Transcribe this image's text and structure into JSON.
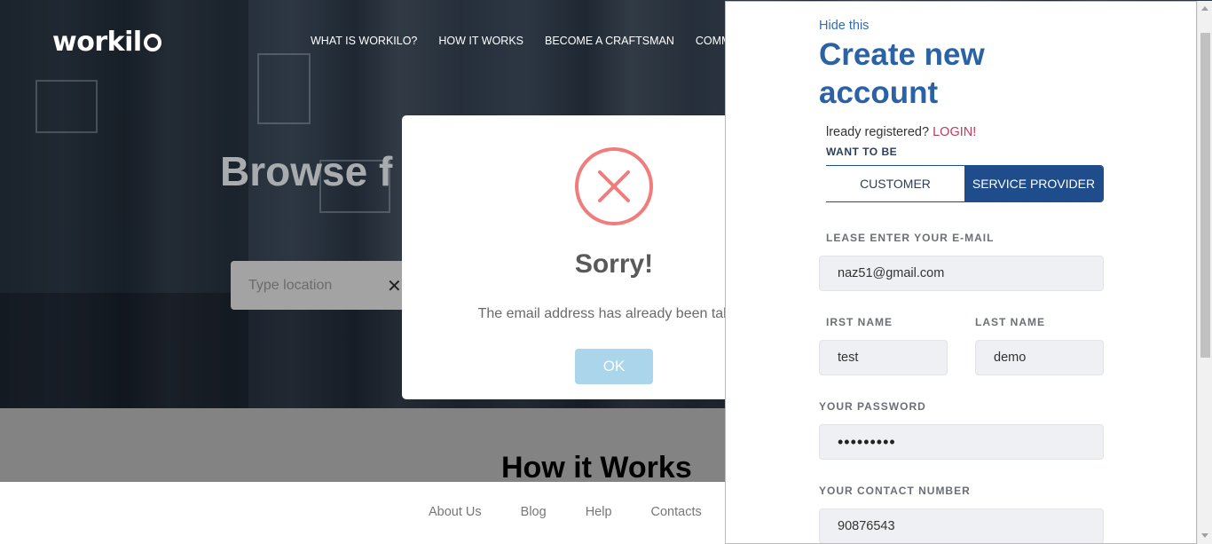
{
  "site": {
    "logo": "workil",
    "nav": [
      "WHAT IS WORKILO?",
      "HOW IT WORKS",
      "BECOME A CRAFTSMAN",
      "COMM"
    ],
    "hero_title": "Browse f",
    "location_placeholder": "Type location",
    "section_title": "How it Works",
    "footer_links": [
      "About Us",
      "Blog",
      "Help",
      "Contacts"
    ]
  },
  "dialog": {
    "icon": "error-x-icon",
    "title": "Sorry!",
    "message": "The email address has already been taken.",
    "ok_label": "OK",
    "colors": {
      "icon": "#f07c7c",
      "ok_button": "#aad5eb"
    }
  },
  "signup_panel": {
    "hide_link": "Hide this",
    "title": "Create new account",
    "already_text": "lready registered?",
    "login_link": "LOGIN!",
    "want_label": "WANT TO BE",
    "roles": {
      "customer": "CUSTOMER",
      "provider": "SERVICE PROVIDER",
      "selected": "SERVICE PROVIDER"
    },
    "email_label": "LEASE ENTER YOUR E-MAIL",
    "email_value": "naz51@gmail.com",
    "first_name_label": "IRST NAME",
    "first_name_value": "test",
    "last_name_label": "LAST NAME",
    "last_name_value": "demo",
    "password_label": "YOUR PASSWORD",
    "password_value": "•••••••••",
    "contact_label": "YOUR CONTACT NUMBER",
    "contact_value": "90876543",
    "colors": {
      "accent": "#1f4d8c",
      "title": "#2b62a5",
      "login": "#c0395a"
    }
  }
}
